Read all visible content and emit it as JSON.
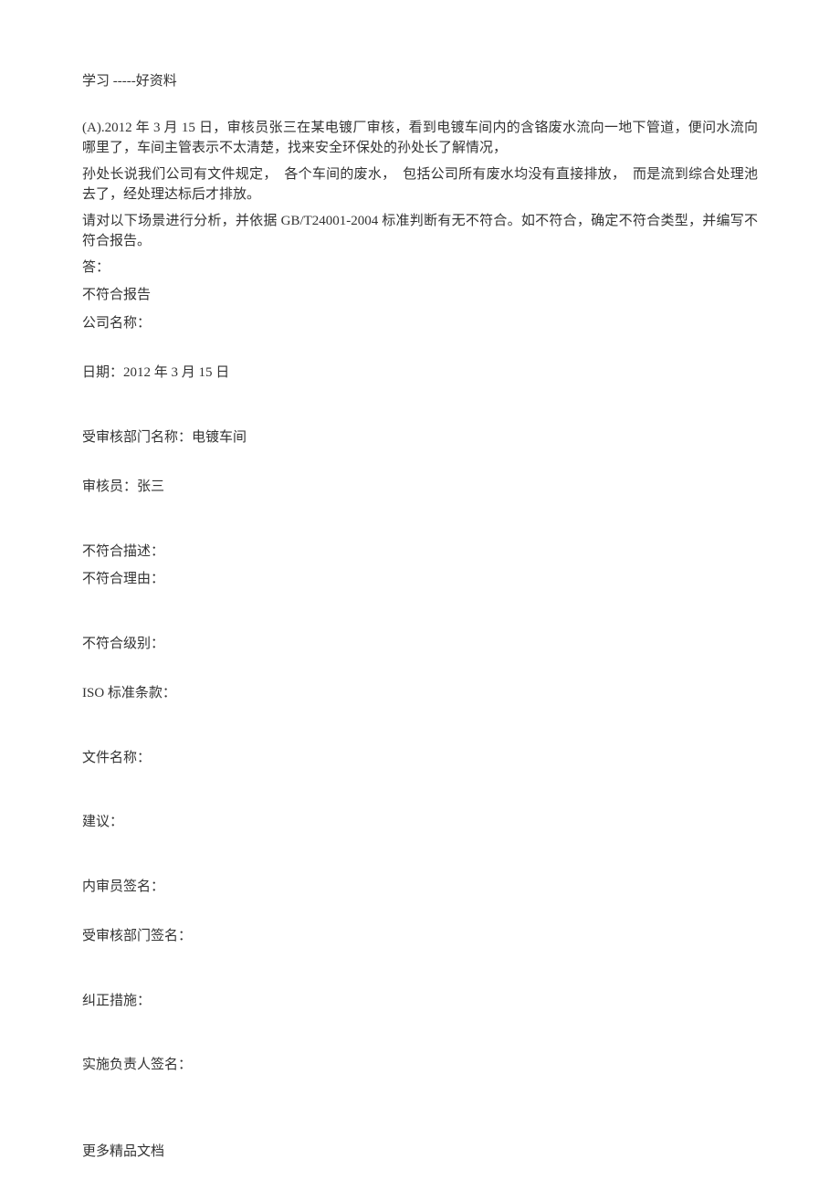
{
  "header": "学习 -----好资料",
  "paragraphs": {
    "p1": "(A).2012 年 3 月 15 日，审核员张三在某电镀厂审核，看到电镀车间内的含铬废水流向一地下管道，便问水流向哪里了，车间主管表示不太清楚，找来安全环保处的孙处长了解情况，",
    "p2": "孙处长说我们公司有文件规定，　各个车间的废水，　包括公司所有废水均没有直接排放，　而是流到综合处理池去了，经处理达标后才排放。",
    "p3": "请对以下场景进行分析，并依据 GB/T24001-2004 标准判断有无不符合。如不符合，确定不符合类型，并编写不符合报告。"
  },
  "fields": {
    "answer": "答：",
    "nonconformity_report": "不符合报告",
    "company_name": "公司名称：",
    "date": "日期：2012 年 3 月 15 日",
    "audited_dept": "受审核部门名称：电镀车间",
    "auditor": "审核员：张三",
    "nonconformity_desc": "不符合描述：",
    "nonconformity_reason": "不符合理由：",
    "nonconformity_level": "不符合级别：",
    "iso_clause": "ISO 标准条款：",
    "file_name": "文件名称：",
    "suggestion": "建议：",
    "internal_auditor_sig": "内审员签名：",
    "audited_dept_sig": "受审核部门签名：",
    "corrective_action": "纠正措施：",
    "responsible_sig": "实施负责人签名："
  },
  "footer": "更多精品文档"
}
